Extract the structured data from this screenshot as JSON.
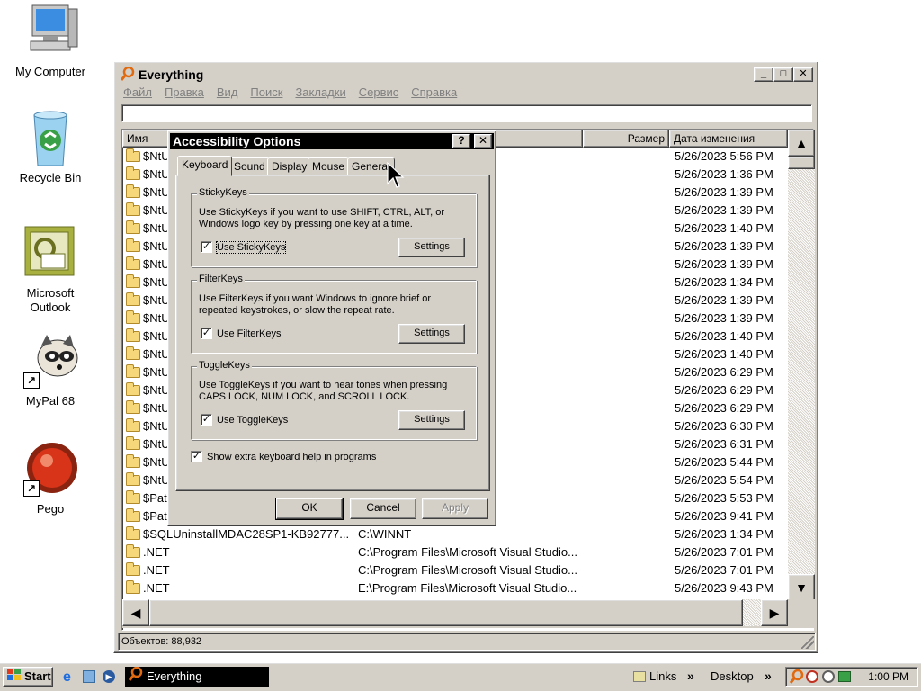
{
  "desktop": {
    "icons": [
      {
        "label": "My Computer"
      },
      {
        "label": "Recycle Bin"
      },
      {
        "label": "Microsoft Outlook"
      },
      {
        "label": "MyPal 68"
      },
      {
        "label": "Pego"
      }
    ]
  },
  "window": {
    "title": "Everything",
    "menu": [
      "Файл",
      "Правка",
      "Вид",
      "Поиск",
      "Закладки",
      "Сервис",
      "Справка"
    ],
    "search_value": "",
    "columns": {
      "name": "Имя",
      "size": "Размер",
      "date": "Дата изменения"
    },
    "rows": [
      {
        "name": "$NtU",
        "path": "",
        "date": "5/26/2023 5:56 PM"
      },
      {
        "name": "$NtU",
        "path": "",
        "date": "5/26/2023 1:36 PM"
      },
      {
        "name": "$NtU",
        "path": "",
        "date": "5/26/2023 1:39 PM"
      },
      {
        "name": "$NtU",
        "path": "",
        "date": "5/26/2023 1:39 PM"
      },
      {
        "name": "$NtU",
        "path": "",
        "date": "5/26/2023 1:40 PM"
      },
      {
        "name": "$NtU",
        "path": "",
        "date": "5/26/2023 1:39 PM"
      },
      {
        "name": "$NtU",
        "path": "",
        "date": "5/26/2023 1:39 PM"
      },
      {
        "name": "$NtU",
        "path": "",
        "date": "5/26/2023 1:34 PM"
      },
      {
        "name": "$NtU",
        "path": "",
        "date": "5/26/2023 1:39 PM"
      },
      {
        "name": "$NtU",
        "path": "",
        "date": "5/26/2023 1:39 PM"
      },
      {
        "name": "$NtU",
        "path": "",
        "date": "5/26/2023 1:40 PM"
      },
      {
        "name": "$NtU",
        "path": "",
        "date": "5/26/2023 1:40 PM"
      },
      {
        "name": "$NtU",
        "path": "",
        "date": "5/26/2023 6:29 PM"
      },
      {
        "name": "$NtU",
        "path": "",
        "date": "5/26/2023 6:29 PM"
      },
      {
        "name": "$NtU",
        "path": "",
        "date": "5/26/2023 6:29 PM"
      },
      {
        "name": "$NtU",
        "path": "",
        "date": "5/26/2023 6:30 PM"
      },
      {
        "name": "$NtU",
        "path": "",
        "date": "5/26/2023 6:31 PM"
      },
      {
        "name": "$NtU",
        "path": "",
        "date": "5/26/2023 5:44 PM"
      },
      {
        "name": "$NtU",
        "path": "",
        "date": "5/26/2023 5:54 PM"
      },
      {
        "name": "$Patc",
        "path": "",
        "date": "5/26/2023 5:53 PM"
      },
      {
        "name": "$Patc",
        "path": "",
        "date": "5/26/2023 9:41 PM"
      },
      {
        "name": "$SQLUninstallMDAC28SP1-KB92777...",
        "path": "C:\\WINNT",
        "date": "5/26/2023 1:34 PM"
      },
      {
        "name": ".NET",
        "path": "C:\\Program Files\\Microsoft Visual Studio...",
        "date": "5/26/2023 7:01 PM"
      },
      {
        "name": ".NET",
        "path": "C:\\Program Files\\Microsoft Visual Studio...",
        "date": "5/26/2023 7:01 PM"
      },
      {
        "name": ".NET",
        "path": "E:\\Program Files\\Microsoft Visual Studio...",
        "date": "5/26/2023 9:43 PM"
      }
    ],
    "status": "Объектов: 88,932"
  },
  "dialog": {
    "title": "Accessibility Options",
    "help_btn": "?",
    "close_btn": "✕",
    "tabs": [
      "Keyboard",
      "Sound",
      "Display",
      "Mouse",
      "General"
    ],
    "active_tab": "Keyboard",
    "sticky": {
      "legend": "StickyKeys",
      "desc": "Use StickyKeys if you want to use SHIFT, CTRL, ALT, or Windows logo key by pressing one key at a time.",
      "check_label": "Use StickyKeys",
      "checked": true,
      "settings": "Settings"
    },
    "filter": {
      "legend": "FilterKeys",
      "desc": "Use FilterKeys if you want Windows to ignore brief or repeated keystrokes, or slow the repeat rate.",
      "check_label": "Use FilterKeys",
      "checked": true,
      "settings": "Settings"
    },
    "toggle": {
      "legend": "ToggleKeys",
      "desc": "Use ToggleKeys if you want to hear tones when pressing CAPS LOCK, NUM LOCK, and SCROLL LOCK.",
      "check_label": "Use ToggleKeys",
      "checked": true,
      "settings": "Settings"
    },
    "extra_help": {
      "label": "Show extra keyboard help in programs",
      "checked": true
    },
    "ok": "OK",
    "cancel": "Cancel",
    "apply": "Apply"
  },
  "taskbar": {
    "start": "Start",
    "task": "Everything",
    "links": "Links",
    "desktop": "Desktop",
    "clock": "1:00 PM"
  },
  "colors": {
    "face": "#d4d0c8",
    "title_active": "#000000",
    "desktop": "#ffffff"
  }
}
